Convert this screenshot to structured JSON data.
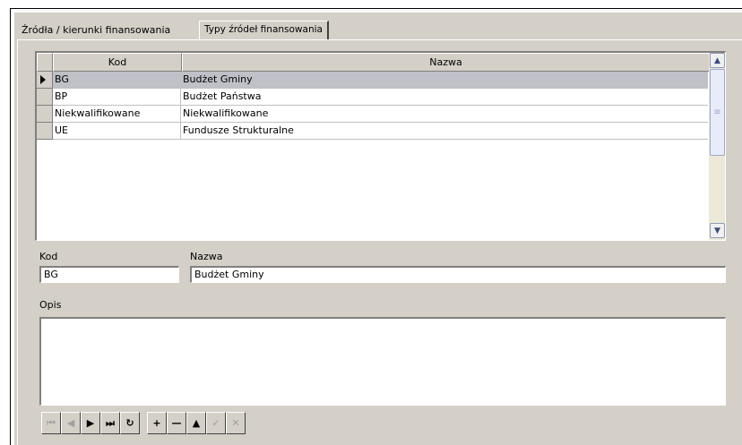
{
  "tabs": [
    {
      "label": "Źródła / kierunki finansowania",
      "active": false
    },
    {
      "label": "Typy źródeł finansowania",
      "active": true
    }
  ],
  "grid": {
    "columns": [
      "Kod",
      "Nazwa"
    ],
    "rows": [
      {
        "kod": "BG",
        "nazwa": "Budżet Gminy",
        "selected": true
      },
      {
        "kod": "BP",
        "nazwa": "Budżet Państwa",
        "selected": false
      },
      {
        "kod": "Niekwalifikowane",
        "nazwa": "Niekwalifikowane",
        "selected": false
      },
      {
        "kod": "UE",
        "nazwa": "Fundusze Strukturalne",
        "selected": false
      }
    ]
  },
  "form": {
    "kod_label": "Kod",
    "kod_value": "BG",
    "nazwa_label": "Nazwa",
    "nazwa_value": "Budżet Gminy",
    "opis_label": "Opis",
    "opis_value": ""
  },
  "navigator": {
    "buttons": [
      {
        "name": "first-record-button",
        "glyph": "⏮",
        "enabled": false
      },
      {
        "name": "prior-record-button",
        "glyph": "◀",
        "enabled": false
      },
      {
        "name": "next-record-button",
        "glyph": "▶",
        "enabled": true
      },
      {
        "name": "last-record-button",
        "glyph": "⏭",
        "enabled": true
      },
      {
        "name": "refresh-button",
        "glyph": "↻",
        "enabled": true
      },
      {
        "name": "insert-button",
        "glyph": "+",
        "enabled": true
      },
      {
        "name": "delete-button",
        "glyph": "—",
        "enabled": true
      },
      {
        "name": "edit-button",
        "glyph": "▲",
        "enabled": true
      },
      {
        "name": "post-button",
        "glyph": "✓",
        "enabled": false
      },
      {
        "name": "cancel-button",
        "glyph": "✕",
        "enabled": false
      }
    ]
  },
  "colors": {
    "face": "#d4d0c8",
    "selected_row": "#c0c0c8"
  }
}
